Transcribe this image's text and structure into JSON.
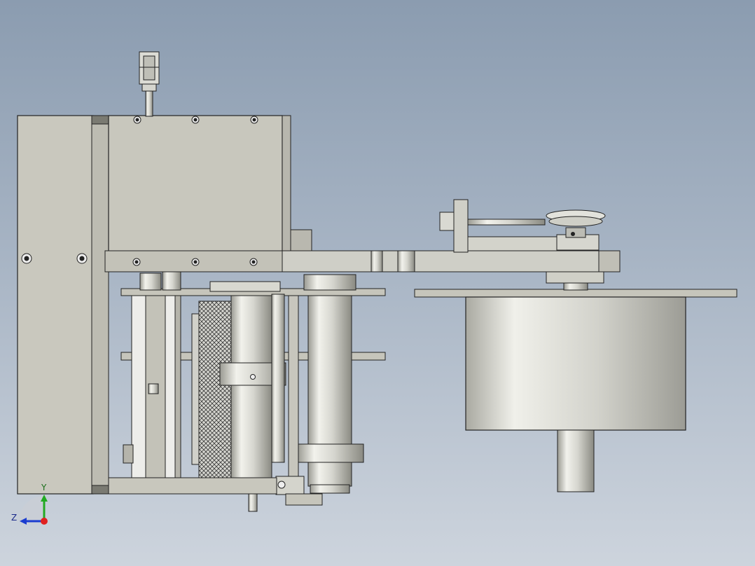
{
  "triad": {
    "y_label": "Y",
    "z_label": "Z",
    "y_color": "#22aa22",
    "z_color": "#1a3cd0",
    "x_color": "#e02020"
  },
  "colors": {
    "background_top": "#8b9cb0",
    "background_bottom": "#cdd4dd",
    "body": "#c8c7bd",
    "edge": "#222222"
  }
}
